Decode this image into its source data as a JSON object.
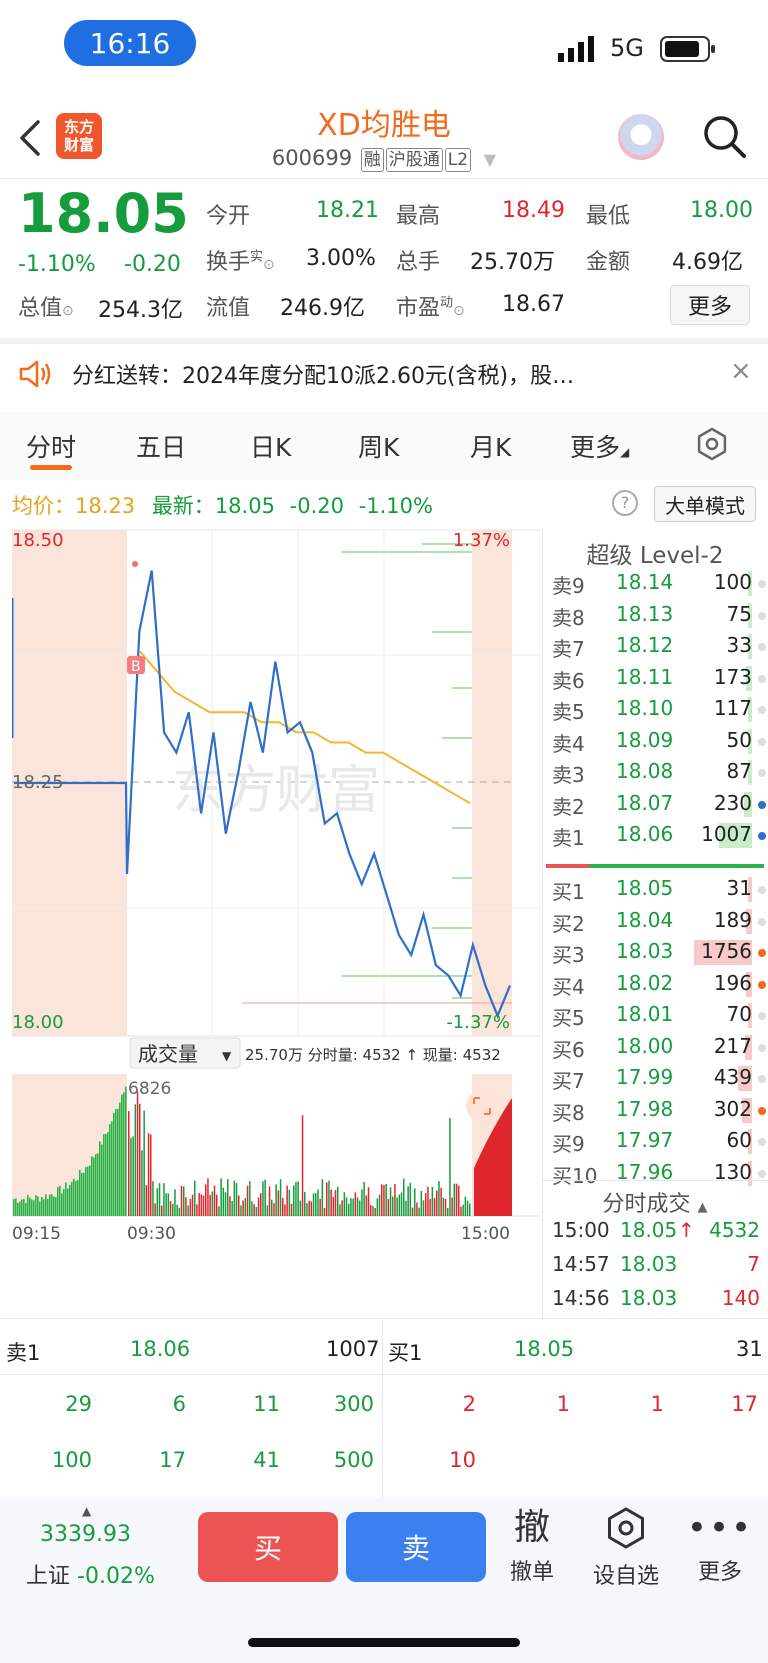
{
  "status": {
    "time": "16:16",
    "network": "5G"
  },
  "header": {
    "logo_line1": "东方",
    "logo_line2": "财富",
    "stock_name": "XD均胜电",
    "code": "600699",
    "tags": [
      "融",
      "沪股通",
      "L2"
    ]
  },
  "quote": {
    "price": "18.05",
    "change_pct": "-1.10%",
    "change": "-0.20",
    "open_label": "今开",
    "open": "18.21",
    "high_label": "最高",
    "high": "18.49",
    "low_label": "最低",
    "low": "18.00",
    "turnover_label": "换手",
    "turnover_sup": "实",
    "turnover": "3.00%",
    "volume_label": "总手",
    "volume": "25.70万",
    "amount_label": "金额",
    "amount": "4.69亿",
    "mktcap_label": "总值",
    "mktcap": "254.3亿",
    "float_label": "流值",
    "float_cap": "246.9亿",
    "pe_label": "市盈",
    "pe_sup": "动",
    "pe": "18.67",
    "more": "更多"
  },
  "notice": {
    "text": "分红送转：2024年度分配10派2.60元(含税)，股…"
  },
  "tabs": [
    "分时",
    "五日",
    "日K",
    "周K",
    "月K",
    "更多"
  ],
  "info_line": {
    "avg_label": "均价：",
    "avg": "18.23",
    "last_label": "最新：",
    "last": "18.05",
    "chg": "-0.20",
    "pct": "-1.10%"
  },
  "big_order_button": "大单模式",
  "chart_data": {
    "type": "line",
    "price_axis": {
      "top": "18.50",
      "mid": "18.25",
      "bottom": "18.00",
      "top_pct": "1.37%",
      "bottom_pct": "-1.37%",
      "ylim": [
        18.0,
        18.5
      ]
    },
    "time_labels": [
      "09:15",
      "09:30",
      "15:00"
    ],
    "price_series": [
      18.25,
      18.25,
      18.25,
      18.25,
      18.16,
      18.4,
      18.46,
      18.3,
      18.28,
      18.32,
      18.22,
      18.3,
      18.2,
      18.26,
      18.33,
      18.28,
      18.37,
      18.3,
      18.31,
      18.28,
      18.21,
      18.22,
      18.18,
      18.15,
      18.18,
      18.14,
      18.1,
      18.08,
      18.12,
      18.07,
      18.06,
      18.04,
      18.09,
      18.05,
      18.02,
      18.05
    ],
    "avg_series": [
      18.38,
      18.36,
      18.34,
      18.33,
      18.32,
      18.32,
      18.32,
      18.31,
      18.31,
      18.3,
      18.3,
      18.29,
      18.29,
      18.28,
      18.28,
      18.27,
      18.26,
      18.25,
      18.24,
      18.23
    ],
    "volume_title": "成交量",
    "volume_info": "25.70万 分时量: 4532 ↑ 现量: 4532",
    "volume_max": "6826"
  },
  "level2": {
    "title": "超级 Level-2",
    "asks": [
      {
        "label": "卖9",
        "price": "18.14",
        "vol": "100"
      },
      {
        "label": "卖8",
        "price": "18.13",
        "vol": "75"
      },
      {
        "label": "卖7",
        "price": "18.12",
        "vol": "33"
      },
      {
        "label": "卖6",
        "price": "18.11",
        "vol": "173"
      },
      {
        "label": "卖5",
        "price": "18.10",
        "vol": "117"
      },
      {
        "label": "卖4",
        "price": "18.09",
        "vol": "50"
      },
      {
        "label": "卖3",
        "price": "18.08",
        "vol": "87"
      },
      {
        "label": "卖2",
        "price": "18.07",
        "vol": "230"
      },
      {
        "label": "卖1",
        "price": "18.06",
        "vol": "1007"
      }
    ],
    "bids": [
      {
        "label": "买1",
        "price": "18.05",
        "vol": "31"
      },
      {
        "label": "买2",
        "price": "18.04",
        "vol": "189"
      },
      {
        "label": "买3",
        "price": "18.03",
        "vol": "1756"
      },
      {
        "label": "买4",
        "price": "18.02",
        "vol": "196"
      },
      {
        "label": "买5",
        "price": "18.01",
        "vol": "70"
      },
      {
        "label": "买6",
        "price": "18.00",
        "vol": "217"
      },
      {
        "label": "买7",
        "price": "17.99",
        "vol": "439"
      },
      {
        "label": "买8",
        "price": "17.98",
        "vol": "302"
      },
      {
        "label": "买9",
        "price": "17.97",
        "vol": "60"
      },
      {
        "label": "买10",
        "price": "17.96",
        "vol": "130"
      }
    ]
  },
  "ticks": {
    "title": "分时成交",
    "rows": [
      {
        "time": "15:00",
        "price": "18.05",
        "arrow": "↑",
        "vol": "4532"
      },
      {
        "time": "14:57",
        "price": "18.03",
        "arrow": "",
        "vol": "7"
      },
      {
        "time": "14:56",
        "price": "18.03",
        "arrow": "",
        "vol": "140"
      }
    ]
  },
  "order_queue": {
    "sell_label": "卖1",
    "sell_price": "18.06",
    "sell_total": "1007",
    "buy_label": "买1",
    "buy_price": "18.05",
    "buy_total": "31",
    "sell_row1": [
      "29",
      "6",
      "11",
      "300"
    ],
    "sell_row2": [
      "100",
      "17",
      "41",
      "500"
    ],
    "buy_row1": [
      "2",
      "1",
      "1",
      "17"
    ],
    "buy_row2": [
      "10"
    ]
  },
  "bottom": {
    "index_value": "3339.93",
    "index_name": "上证",
    "index_change": "-0.02%",
    "buy": "买",
    "sell": "卖",
    "cancel_glyph": "撤",
    "cancel": "撤单",
    "watchlist": "设自选",
    "more": "更多"
  }
}
